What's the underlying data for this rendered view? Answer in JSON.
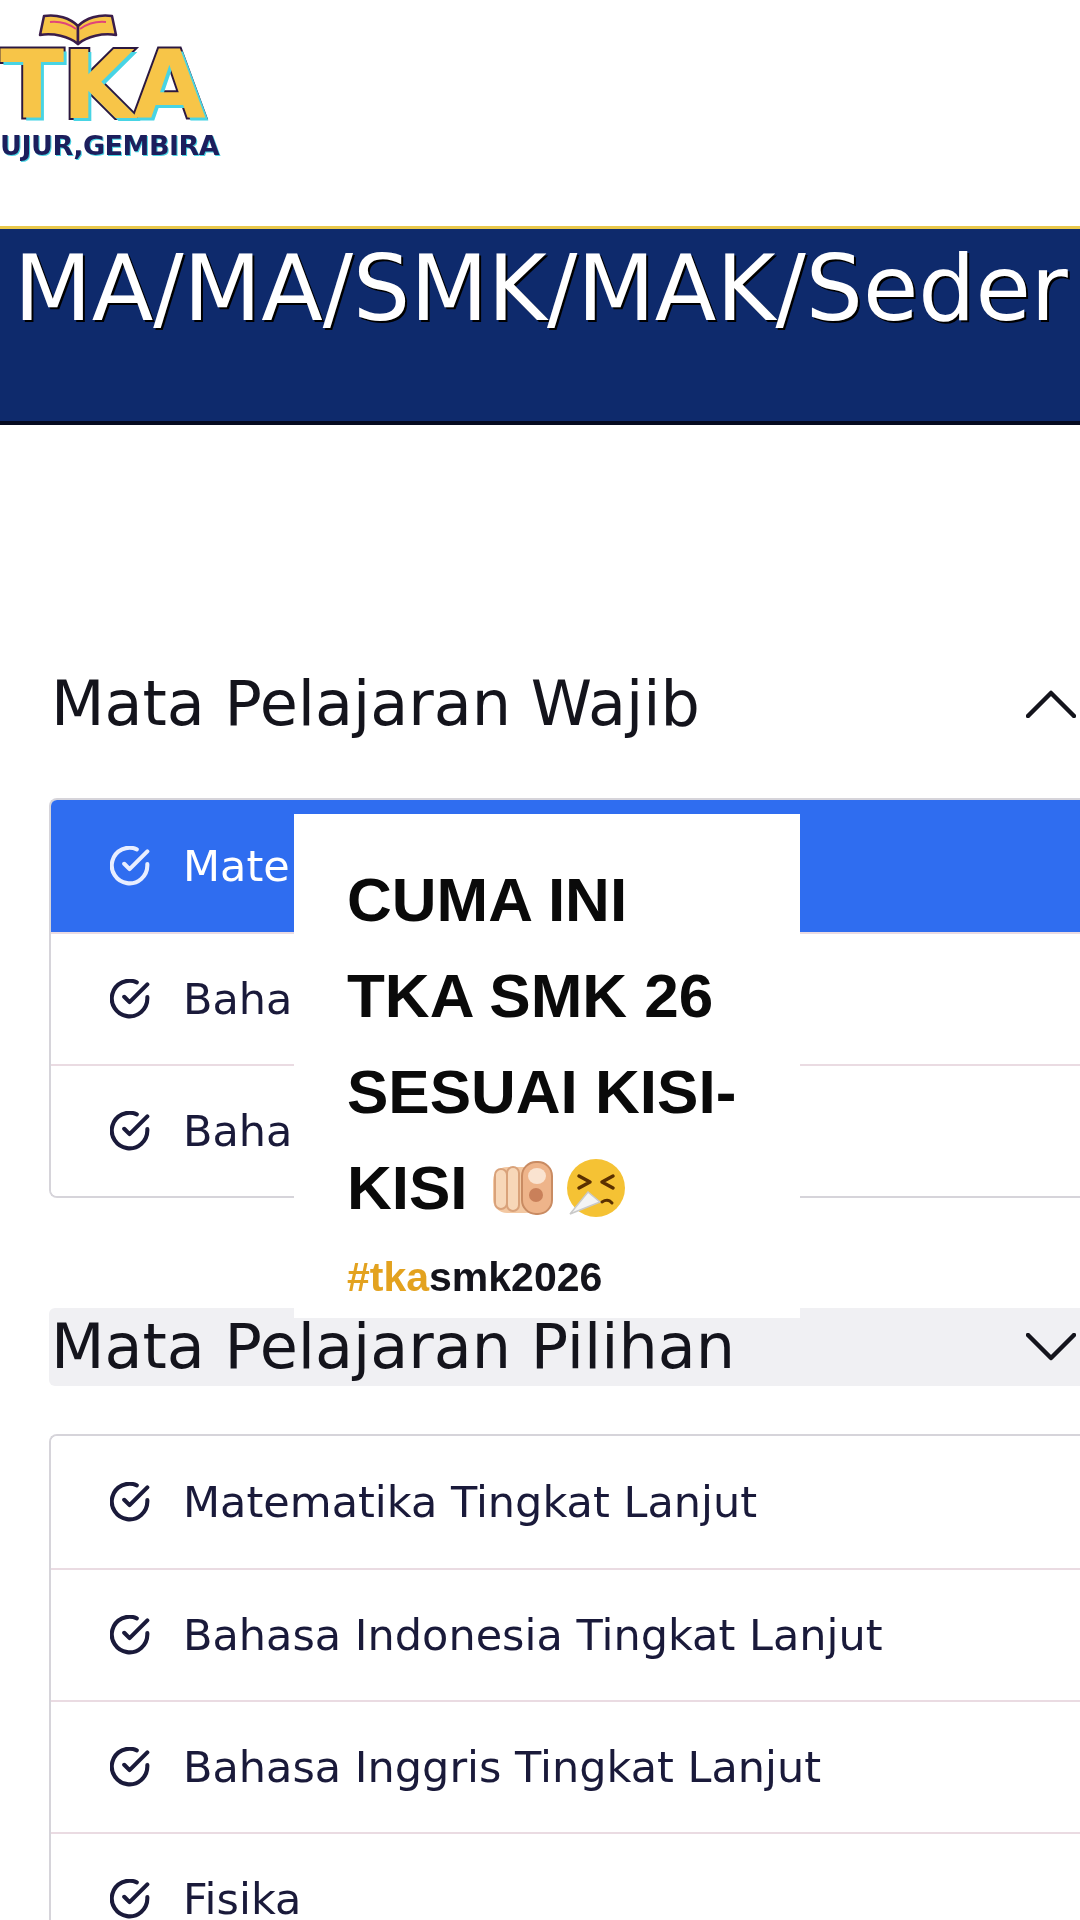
{
  "logo": {
    "wordmark": "TKA",
    "tagline": "UJUR,GEMBIRA"
  },
  "banner": {
    "title": "MA/MA/SMK/MAK/Seder"
  },
  "sections": [
    {
      "title": "Mata Pelajaran Wajib",
      "expanded": true,
      "focused": false,
      "items": [
        {
          "label": "Mate",
          "selected": true
        },
        {
          "label": "Baha",
          "selected": false
        },
        {
          "label": "Baha",
          "selected": false
        }
      ]
    },
    {
      "title": "Mata Pelajaran Pilihan",
      "expanded": false,
      "focused": true,
      "items": [
        {
          "label": "Matematika Tingkat Lanjut",
          "selected": false
        },
        {
          "label": "Bahasa Indonesia Tingkat Lanjut",
          "selected": false
        },
        {
          "label": "Bahasa Inggris Tingkat Lanjut",
          "selected": false
        },
        {
          "label": "Fisika",
          "selected": false
        }
      ]
    }
  ],
  "caption": {
    "lines": [
      "CUMA INI",
      "TKA SMK 26",
      "SESUAI KISI-",
      "KISI"
    ],
    "hashtag": {
      "highlight": "#tka",
      "rest": "smk2026"
    }
  }
}
